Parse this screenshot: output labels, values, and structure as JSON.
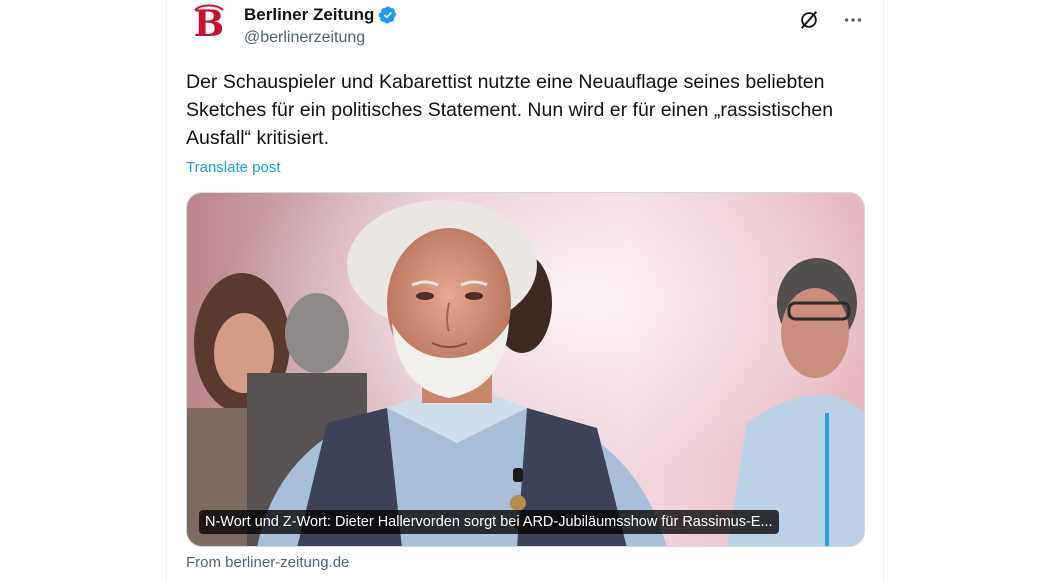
{
  "author": {
    "name": "Berliner Zeitung",
    "handle": "@berlinerzeitung",
    "verified": true,
    "avatar_icon": "berliner-zeitung-logo-icon"
  },
  "actions": {
    "grok_icon": "grok-icon",
    "more_icon": "more-icon"
  },
  "post": {
    "text": "Der Schauspieler und Kabarettist nutzte eine Neuauflage seines beliebten Sketches für ein politisches Statement. Nun wird er für einen „rassistischen Ausfall“ kritisiert.",
    "translate_label": "Translate post"
  },
  "card": {
    "title": "N-Wort und Z-Wort: Dieter Hallervorden sorgt bei ARD-Jubiläumsshow für Rassimus-E...",
    "source": "From berliner-zeitung.de"
  },
  "colors": {
    "accent": "#1d9bf0",
    "verified": "#1d9bf0",
    "logo_red": "#c8102e",
    "secondary_text": "#536471"
  }
}
